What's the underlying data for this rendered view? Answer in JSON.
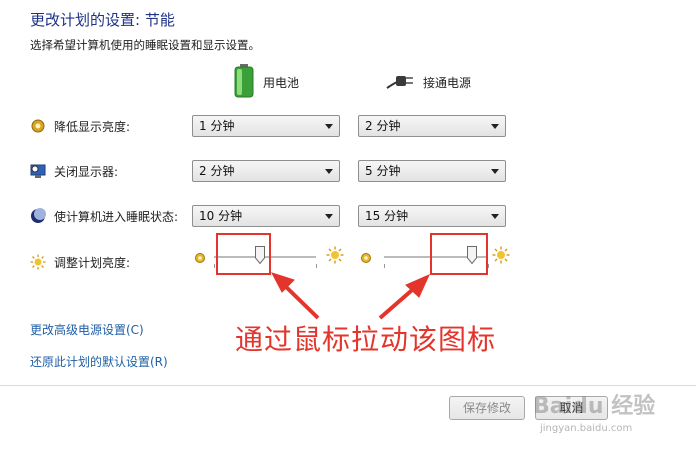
{
  "header": {
    "title": "更改计划的设置: 节能",
    "subtitle": "选择希望计算机使用的睡眠设置和显示设置。"
  },
  "columns": {
    "battery": "用电池",
    "plugged": "接通电源"
  },
  "rows": [
    {
      "label": "降低显示亮度:",
      "battery": "1 分钟",
      "plugged": "2 分钟",
      "icon": "brightness-icon"
    },
    {
      "label": "关闭显示器:",
      "battery": "2 分钟",
      "plugged": "5 分钟",
      "icon": "monitor-clock-icon"
    },
    {
      "label": "使计算机进入睡眠状态:",
      "battery": "10 分钟",
      "plugged": "15 分钟",
      "icon": "sleep-moon-icon"
    }
  ],
  "brightness": {
    "label": "调整计划亮度:",
    "battery_level": 0.45,
    "plugged_level": 0.85
  },
  "links": {
    "advanced": "更改高级电源设置(C)",
    "restore": "还原此计划的默认设置(R)"
  },
  "annotation": "通过鼠标拉动该图标",
  "buttons": {
    "save": "保存修改",
    "cancel": "取消"
  },
  "watermark": {
    "text": "Baidu 经验",
    "sub": "jingyan.baidu.com"
  },
  "colors": {
    "title": "#1e3287",
    "link": "#1f5fa6",
    "annotation": "#e3352c"
  }
}
